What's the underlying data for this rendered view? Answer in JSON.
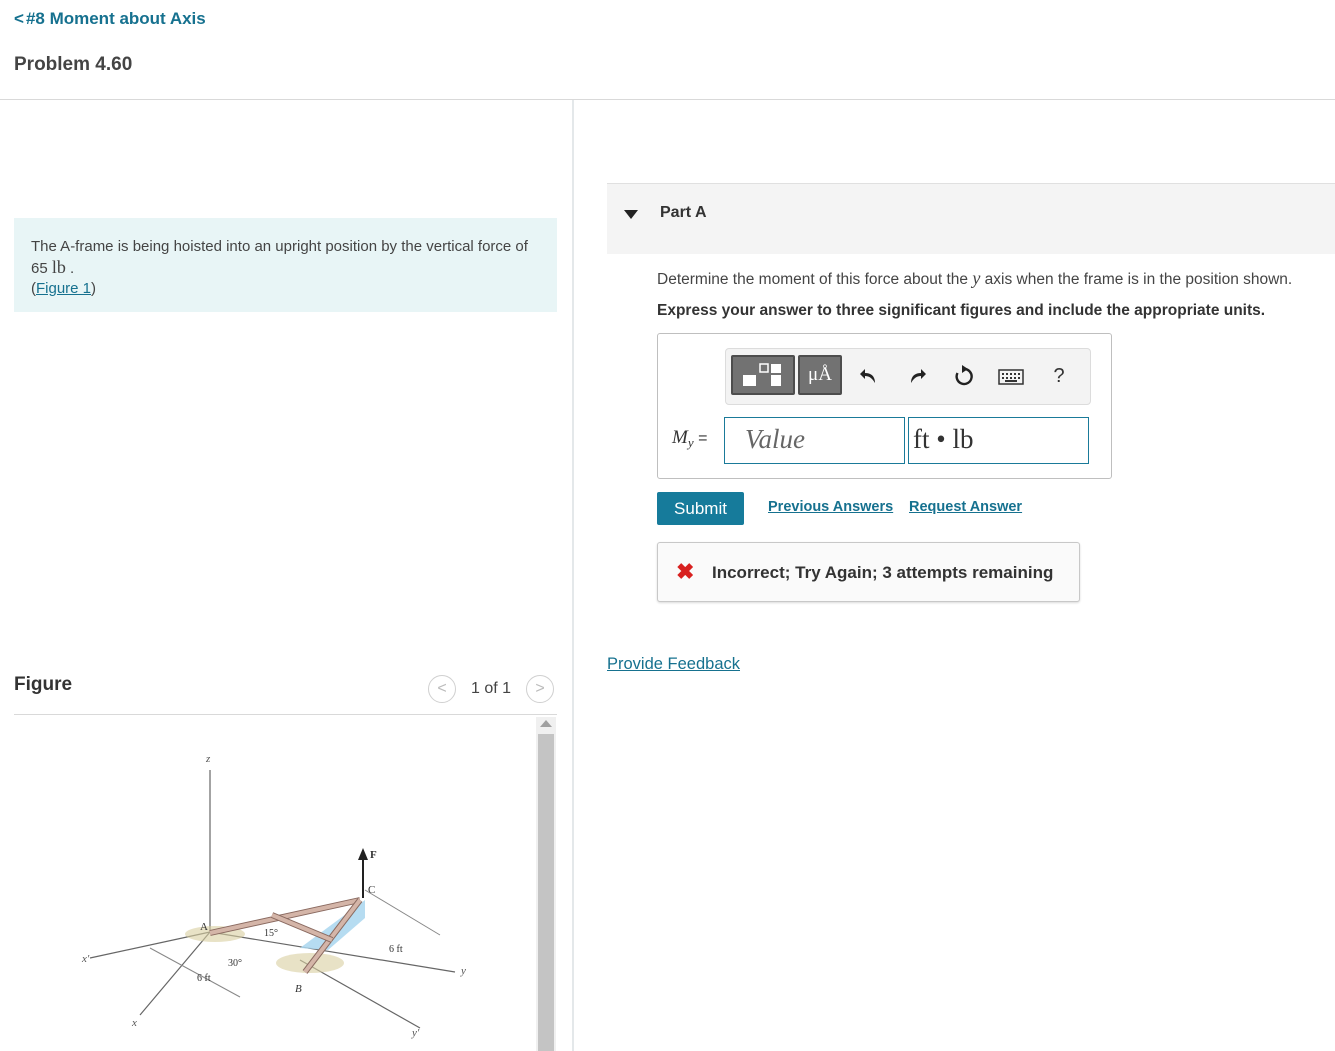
{
  "nav": {
    "back_label": "#8 Moment about Axis",
    "problem_title": "Problem 4.60"
  },
  "problem": {
    "text_before": "The A-frame is being hoisted into an upright position by the vertical force of 65",
    "unit": "lb",
    "text_after": ".",
    "figure_link_open": "(",
    "figure_link": "Figure 1",
    "figure_link_close": ")"
  },
  "figure_panel": {
    "label": "Figure",
    "pager_text": "1 of 1",
    "prev_symbol": "<",
    "next_symbol": ">",
    "diagram_labels": {
      "z": "z",
      "F": "F",
      "C": "C",
      "A": "A",
      "B": "B",
      "x_prime": "x′",
      "x": "x",
      "y": "y",
      "y_prime": "y′",
      "angle_15": "15°",
      "angle_30": "30°",
      "dist_left": "6 ft",
      "dist_right": "6 ft"
    }
  },
  "part": {
    "title": "Part A",
    "question_before": "Determine the moment of this force about the",
    "question_var": "y",
    "question_after": "axis when the frame is in the position shown.",
    "instructions": "Express your answer to three significant figures and include the appropriate units."
  },
  "toolbar": {
    "units_btn_label": "μÅ",
    "help_label": "?",
    "icons": [
      "templates-icon",
      "units-icon",
      "undo-icon",
      "redo-icon",
      "reset-icon",
      "keyboard-icon",
      "help-icon"
    ]
  },
  "answer": {
    "variable": "M",
    "subscript": "y",
    "equals": "=",
    "value_placeholder": "Value",
    "units_value": "ft • lb"
  },
  "actions": {
    "submit": "Submit",
    "previous_answers": "Previous Answers",
    "request_answer": "Request Answer"
  },
  "feedback": {
    "symbol": "✖",
    "message": "Incorrect; Try Again; 3 attempts remaining"
  },
  "provide_feedback": "Provide Feedback",
  "colors": {
    "link": "#16718f",
    "submit_bg": "#167b9b",
    "problem_bg": "#e8f5f6",
    "incorrect": "#d8201f"
  }
}
